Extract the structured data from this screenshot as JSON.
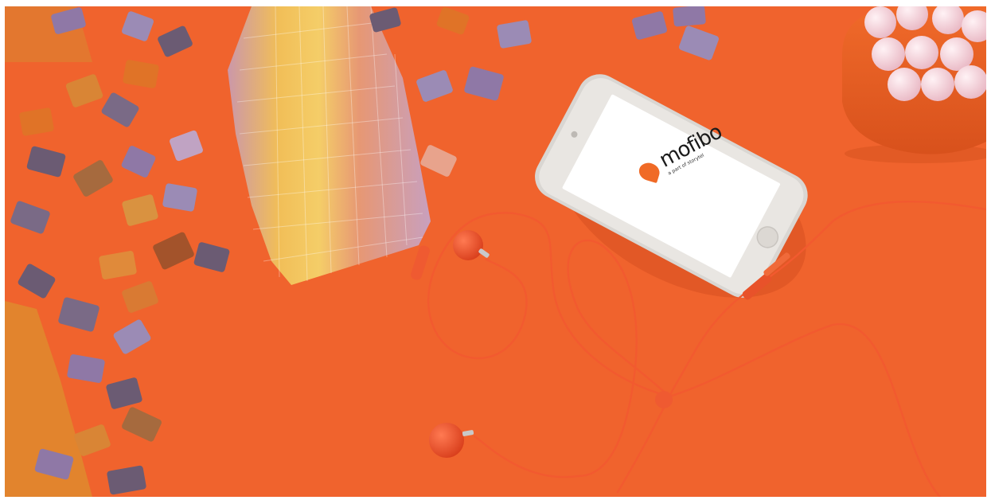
{
  "photo": {
    "background_color": "#f0632d",
    "cable_color": "#f25a2f",
    "puzzle_colors": [
      "#e07327",
      "#8f78a6",
      "#c0a3c3",
      "#d99240",
      "#6b5b73"
    ],
    "marshmallow_color": "#f3d6dc"
  },
  "phone": {
    "brand": "mofibo",
    "tagline": "a part of storytel",
    "logo_color": "#f06a26"
  }
}
